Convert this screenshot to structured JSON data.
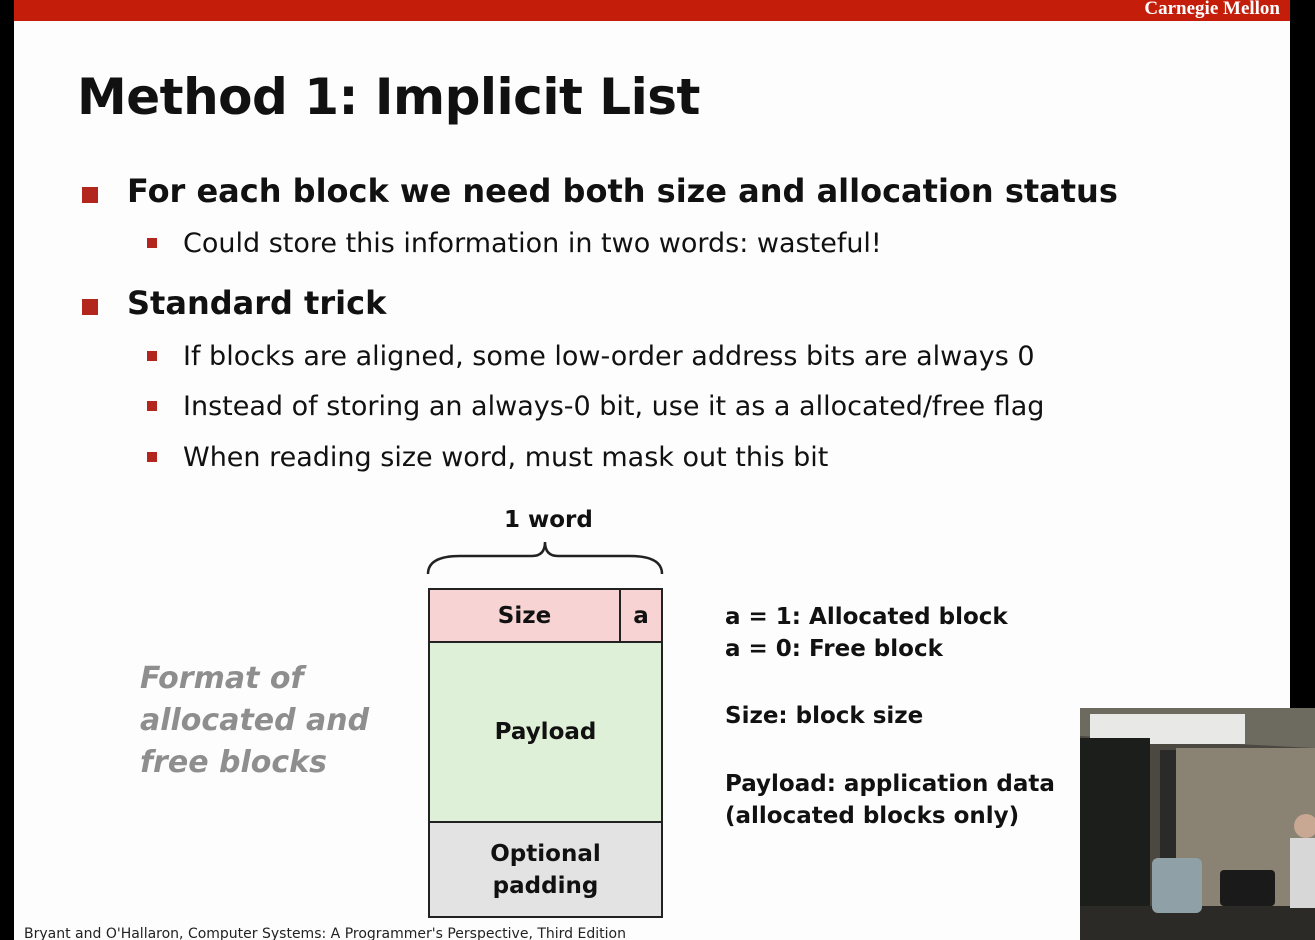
{
  "header": {
    "brand": "Carnegie Mellon"
  },
  "slide": {
    "title": "Method 1: Implicit List",
    "bullets": [
      {
        "text": "For each block we need both size and allocation status",
        "sub": [
          "Could store this information in two words: wasteful!"
        ]
      },
      {
        "text": "Standard trick",
        "sub": [
          "If blocks are aligned, some low-order address bits are always 0",
          "Instead of storing an always-0 bit, use it as a allocated/free flag",
          "When reading size word, must mask out this bit"
        ]
      }
    ],
    "diagram": {
      "word_label": "1 word",
      "size_label": "Size",
      "a_label": "a",
      "payload_label": "Payload",
      "padding_label_1": "Optional",
      "padding_label_2": "padding",
      "caption": "Format of allocated and free blocks",
      "legend": [
        "a = 1: Allocated block",
        "a = 0: Free block",
        "Size: block size",
        "Payload: application data",
        "(allocated blocks only)"
      ]
    },
    "footer": "Bryant and O'Hallaron, Computer Systems: A Programmer's Perspective, Third Edition"
  },
  "colors": {
    "top_bar": "#c41e0a",
    "bullet_marker": "#b3261e",
    "size_header_fill": "#f7d3d3",
    "payload_fill": "#dff0d8",
    "padding_fill": "#e3e3e3",
    "caption_text": "#8e8e8e"
  },
  "webcam": {
    "description_icon": "video-feed-icon"
  }
}
